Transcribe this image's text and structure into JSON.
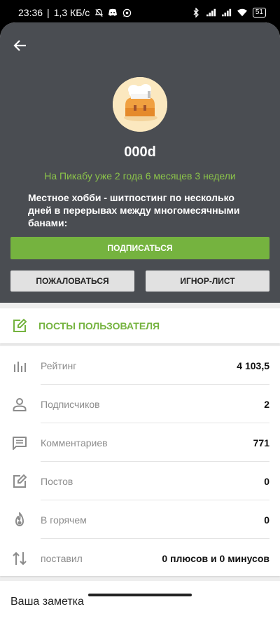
{
  "status_bar": {
    "time": "23:36",
    "net_speed": "1,3 КБ/с",
    "battery": "51"
  },
  "profile": {
    "username": "000d",
    "since": "На Пикабу уже 2 года 6 месяцев 3 недели",
    "about": "Местное хобби - шитпостинг по несколько дней в перерывах между многомесячными банами:",
    "subscribe_label": "ПОДПИСАТЬСЯ",
    "report_label": "ПОЖАЛОВАТЬСЯ",
    "ignore_label": "ИГНОР-ЛИСТ"
  },
  "posts_link": {
    "label": "ПОСТЫ ПОЛЬЗОВАТЕЛЯ"
  },
  "stats": [
    {
      "icon": "bar-chart-icon",
      "name": "Рейтинг",
      "value": "4 103,5"
    },
    {
      "icon": "person-icon",
      "name": "Подписчиков",
      "value": "2"
    },
    {
      "icon": "comment-icon",
      "name": "Комментариев",
      "value": "771"
    },
    {
      "icon": "edit-icon",
      "name": "Постов",
      "value": "0"
    },
    {
      "icon": "flame-icon",
      "name": "В горячем",
      "value": "0"
    },
    {
      "icon": "sort-arrows-icon",
      "name": "поставил",
      "value": "0 плюсов и 0 минусов"
    }
  ],
  "note": {
    "title": "Ваша заметка"
  },
  "colors": {
    "accent": "#75b33f",
    "since_text": "#8bc34a",
    "header_bg": "#4a4d52"
  }
}
